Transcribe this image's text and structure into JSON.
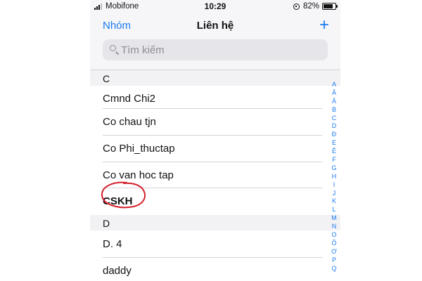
{
  "status_bar": {
    "carrier": "Mobifone",
    "time": "10:29",
    "battery": "82%",
    "battery_level": 0.82
  },
  "nav": {
    "left_label": "Nhóm",
    "title": "Liên hệ",
    "add_label": "+"
  },
  "search": {
    "placeholder": "Tìm kiếm"
  },
  "sections": [
    {
      "header": "C",
      "contacts": [
        "Cmnd Chi2",
        "Co chau tjn",
        "Co Phi_thuctap",
        "Co van hoc tap",
        "CSKH"
      ]
    },
    {
      "header": "D",
      "contacts": [
        "D. 4",
        "daddy"
      ]
    }
  ],
  "index_letters": [
    "A",
    "Ă",
    "Â",
    "B",
    "C",
    "D",
    "Đ",
    "E",
    "Ê",
    "F",
    "G",
    "H",
    "I",
    "J",
    "K",
    "L",
    "M",
    "N",
    "O",
    "Ô",
    "Ơ",
    "P",
    "Q"
  ],
  "colors": {
    "accent": "#1a7bf0",
    "annotation": "#d6202c"
  }
}
